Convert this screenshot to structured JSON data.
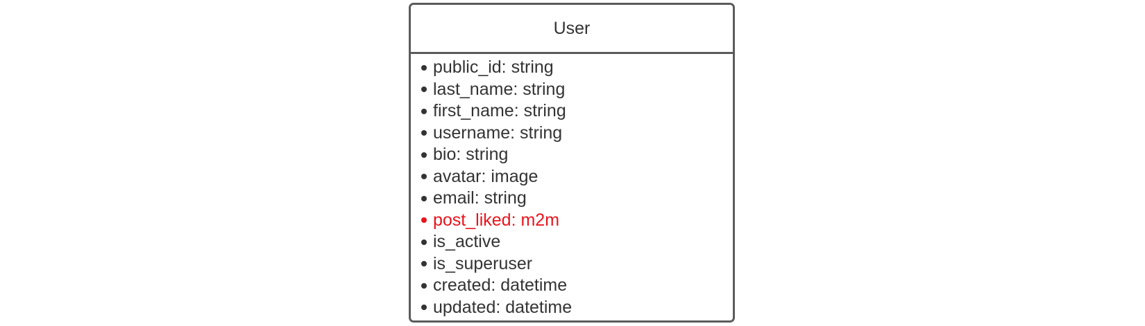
{
  "entity": {
    "title": "User",
    "highlight_color": "#e8141c",
    "fields": [
      {
        "text": "public_id: string",
        "highlight": false
      },
      {
        "text": "last_name: string",
        "highlight": false
      },
      {
        "text": "first_name: string",
        "highlight": false
      },
      {
        "text": "username: string",
        "highlight": false
      },
      {
        "text": "bio: string",
        "highlight": false
      },
      {
        "text": "avatar: image",
        "highlight": false
      },
      {
        "text": "email: string",
        "highlight": false
      },
      {
        "text": "post_liked: m2m",
        "highlight": true
      },
      {
        "text": "is_active",
        "highlight": false
      },
      {
        "text": "is_superuser",
        "highlight": false
      },
      {
        "text": "created: datetime",
        "highlight": false
      },
      {
        "text": "updated: datetime",
        "highlight": false
      }
    ]
  }
}
